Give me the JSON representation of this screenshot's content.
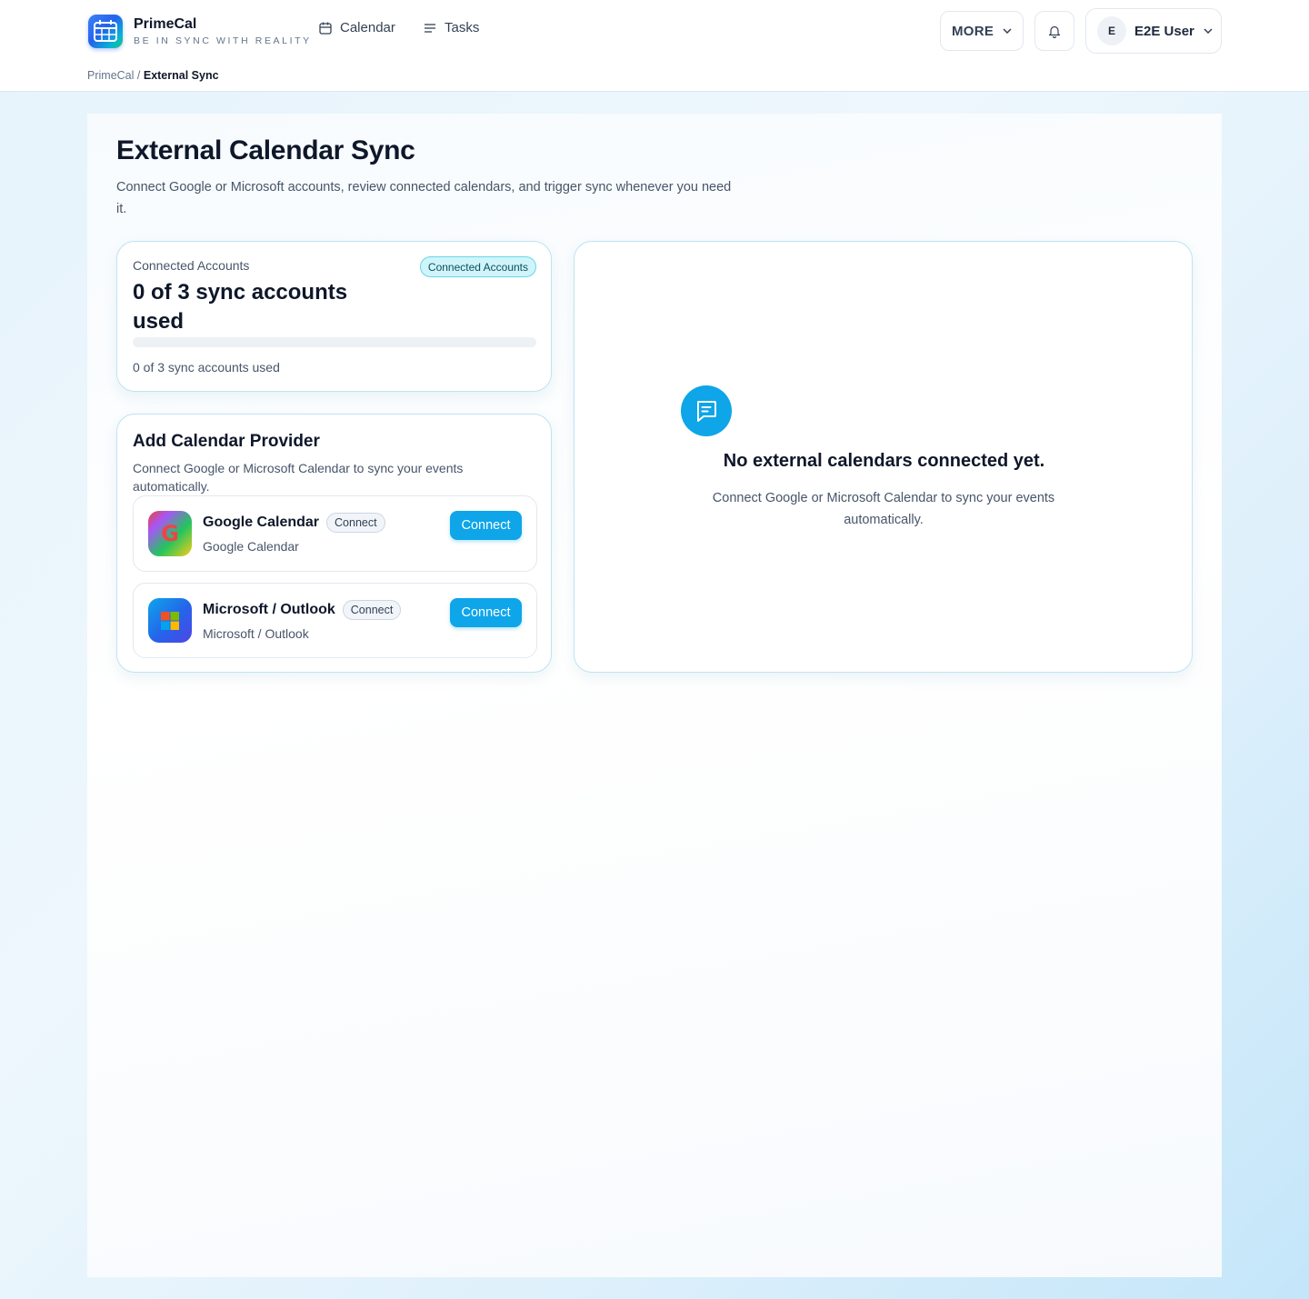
{
  "header": {
    "brand_name": "PrimeCal",
    "brand_tagline": "BE IN SYNC WITH REALITY",
    "nav": [
      {
        "label": "Calendar",
        "icon": "calendar-icon"
      },
      {
        "label": "Tasks",
        "icon": "list-icon"
      }
    ],
    "more_label": "MORE",
    "user": {
      "initial": "E",
      "name": "E2E User"
    }
  },
  "breadcrumb": {
    "root": "PrimeCal",
    "separator": "/",
    "current": "External Sync"
  },
  "page": {
    "title": "External Calendar Sync",
    "description": "Connect Google or Microsoft accounts, review connected calendars, and trigger sync whenever you need it."
  },
  "accounts": {
    "label": "Connected Accounts",
    "badge": "Connected Accounts",
    "value": "0 of 3 sync accounts used",
    "caption": "0 of 3 sync accounts used",
    "used": 0,
    "limit": 3
  },
  "providers_card": {
    "title": "Add Calendar Provider",
    "description": "Connect Google or Microsoft Calendar to sync your events automatically.",
    "providers": [
      {
        "name": "Google Calendar",
        "chip": "Connect",
        "subtitle": "Google Calendar",
        "button": "Connect",
        "icon": "google-icon"
      },
      {
        "name": "Microsoft / Outlook",
        "chip": "Connect",
        "subtitle": "Microsoft / Outlook",
        "button": "Connect",
        "icon": "microsoft-icon"
      }
    ]
  },
  "empty_state": {
    "title": "No external calendars connected yet.",
    "description": "Connect Google or Microsoft Calendar to sync your events automatically.",
    "icon": "message-icon"
  },
  "colors": {
    "accent": "#0ea5e9",
    "badge_bg": "#cff5fb",
    "text_primary": "#0f172a",
    "text_secondary": "#475569"
  }
}
